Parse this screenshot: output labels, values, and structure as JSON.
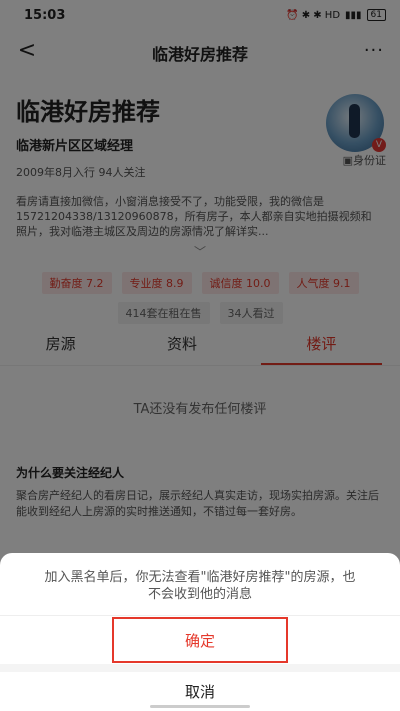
{
  "status": {
    "time": "15:03",
    "icons": "⏰ ✱ ✱ HD",
    "signal": "▮▮▮",
    "battery": "61"
  },
  "nav": {
    "title": "临港好房推荐",
    "back": "<",
    "more": "···"
  },
  "profile": {
    "name": "临港好房推荐",
    "role": "临港新片区区域经理",
    "meta": "2009年8月入行  94人关注",
    "id_card": "▣身份证",
    "bio": "看房请直接加微信，小窗消息接受不了，功能受限，我的微信是15721204338/13120960878，所有房子，本人都亲自实地拍摄视频和照片，我对临港主城区及周边的房源情况了解详实...",
    "expand": "﹀",
    "tags": [
      "勤奋度 7.2",
      "专业度 8.9",
      "诚信度 10.0",
      "人气度 9.1"
    ],
    "stats": [
      "414套在租在售",
      "34人看过"
    ],
    "verified": "V"
  },
  "tabs": [
    "房源",
    "资料",
    "楼评"
  ],
  "empty_text": "TA还没有发布任何楼评",
  "why": {
    "title": "为什么要关注经纪人",
    "text": "聚合房产经纪人的看房日记，展示经纪人真实走访，现场实拍房源。关注后能收到经纪人上房源的实时推送通知，不错过每一套好房。"
  },
  "sheet": {
    "message": "加入黑名单后，你无法查看\"临港好房推荐\"的房源，也不会收到他的消息",
    "confirm": "确定",
    "cancel": "取消"
  }
}
